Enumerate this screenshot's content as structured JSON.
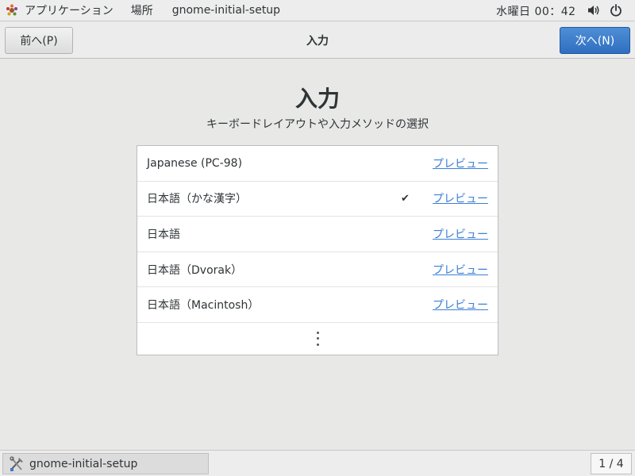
{
  "topbar": {
    "applications_label": "アプリケーション",
    "places_label": "場所",
    "app_name": "gnome-initial-setup",
    "clock": "水曜日 00：42",
    "icons": {
      "applications": "gnome-foot-icon",
      "volume": "speaker-icon",
      "power": "power-icon"
    }
  },
  "header": {
    "prev_label": "前へ(P)",
    "title": "入力",
    "next_label": "次へ(N)",
    "accent_color": "#3a7bd0"
  },
  "main": {
    "title": "入力",
    "subtitle": "キーボードレイアウトや入力メソッドの選択",
    "layouts": [
      {
        "name": "Japanese (PC-98)",
        "selected": false,
        "check": "",
        "preview_label": "プレビュー"
      },
      {
        "name": "日本語（かな漢字）",
        "selected": true,
        "check": "✔",
        "preview_label": "プレビュー"
      },
      {
        "name": "日本語",
        "selected": false,
        "check": "",
        "preview_label": "プレビュー"
      },
      {
        "name": "日本語（Dvorak）",
        "selected": false,
        "check": "",
        "preview_label": "プレビュー"
      },
      {
        "name": "日本語（Macintosh）",
        "selected": false,
        "check": "",
        "preview_label": "プレビュー"
      }
    ],
    "more_icon": "vertical-ellipsis-icon",
    "link_color": "#3c80d6"
  },
  "taskbar": {
    "window_label": "gnome-initial-setup",
    "window_icon": "setup-tools-icon",
    "workspace": "1 / 4"
  }
}
